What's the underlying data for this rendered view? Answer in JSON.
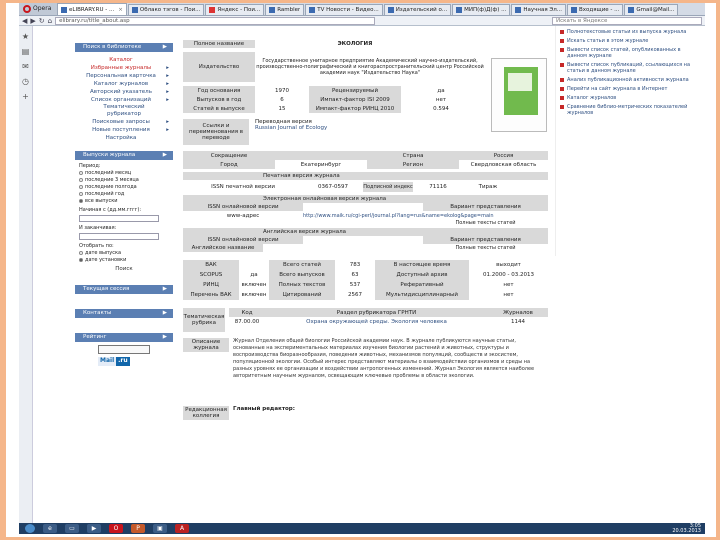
{
  "browser": {
    "app_button": "Opera",
    "tabs": [
      {
        "label": "eLIBRARY.RU - ...",
        "active": true
      },
      {
        "label": "Облако тэгов - Пои..."
      },
      {
        "label": "Яндекс - Пои..."
      },
      {
        "label": "Rambler"
      },
      {
        "label": "TV Новости - Видео..."
      },
      {
        "label": "Издательский о..."
      },
      {
        "label": "МИП(ф)Д(ф) ..."
      },
      {
        "label": "Научная Эл..."
      },
      {
        "label": "Входящие - ..."
      },
      {
        "label": "Gmail@Mail..."
      }
    ],
    "address": "elibrary.ru/title_about.asp",
    "search_placeholder": "Искать в Яндексе"
  },
  "left_nav": {
    "search_header": "Поиск в библиотеке",
    "items": [
      {
        "label": "Каталог",
        "highlight": true
      },
      {
        "label": "Избранные журналы",
        "highlight": true
      },
      {
        "label": "Персональная карточка"
      },
      {
        "label": "Каталог журналов"
      },
      {
        "label": "Авторский указатель"
      },
      {
        "label": "Список организаций"
      },
      {
        "label": "Тематический рубрикатор"
      },
      {
        "label": "Поисковые запросы"
      },
      {
        "label": "Новые поступления"
      },
      {
        "label": "Настройка"
      }
    ],
    "issues_header": "Выпуски журнала",
    "period_label": "Период:",
    "period_options": [
      {
        "label": "последний месяц",
        "on": false
      },
      {
        "label": "последние 3 месяца",
        "on": false
      },
      {
        "label": "последние полгода",
        "on": false
      },
      {
        "label": "последний год",
        "on": false
      },
      {
        "label": "все выпуски",
        "on": true
      }
    ],
    "start_label": "Начиная с (дд.мм.гггг):",
    "end_label": "И заканчивая:",
    "sort_label": "Отобрать по:",
    "sort_options": [
      {
        "label": "дате выпуска",
        "on": false
      },
      {
        "label": "дате установки",
        "on": true
      }
    ],
    "search_button": "Поиск",
    "session_header": "Текущая сессия",
    "contacts_header": "Контакты",
    "rating_header": "Рейтинг",
    "mail_brand_left": "Mail",
    "mail_brand_right": ".ru"
  },
  "journal": {
    "name_label": "Полное название",
    "name": "ЭКОЛОГИЯ",
    "publisher_label": "Издательство",
    "publisher": "Государственное унитарное предприятие Академический научно-издательский, производственно-полиграфический и книгораспространительский центр Российской академии наук \"Издательство Наука\"",
    "stats": [
      [
        "Год основания",
        "1970",
        "Рецензируемый",
        "да"
      ],
      [
        "Выпусков в год",
        "6",
        "Импакт-фактор ISI 2009",
        "нет"
      ],
      [
        "Статей в выпуске",
        "15",
        "Импакт-фактор РИНЦ 2010",
        "0.594"
      ]
    ],
    "links_label": "Ссылки и переименования в переводе",
    "translation_label": "Переводная версия",
    "translation_title": "Russian Journal of Ecology",
    "geo_header": [
      "Сокращение",
      "",
      "Страна",
      "Россия"
    ],
    "geo_values": [
      "Город",
      "Екатеринбург",
      "Регион",
      "Свердловская область"
    ],
    "print_section": "Печатная версия журнала",
    "issn_label": "ISSN печатной версии",
    "issn": "0367-0597",
    "index_label": "Подписной индекс",
    "index": "71116",
    "type": "Тираж",
    "online_section": "Электронная онлайновая версия журнала",
    "online_issn_label": "ISSN онлайновой версии",
    "online_repr_label": "Вариант представления",
    "online_site": "www-адрес",
    "online_url": "http://www.maik.ru/cgi-perl/journal.pl?lang=rus&name=ekolog&page=main",
    "online_repr": "Полные тексты статей",
    "english_section": "Английская версия журнала",
    "english_issn_label": "ISSN онлайновой версии",
    "english_repr_label": "Вариант представления",
    "english_name_label": "Английское название",
    "english_repr": "Полные тексты статей",
    "index_table": [
      [
        "ВАК",
        "",
        "Всего статей",
        "783",
        "В настоящее время",
        "выходит"
      ],
      [
        "SCOPUS",
        "да",
        "Всего выпусков",
        "63",
        "Доступный архив",
        "01.2000 - 03.2013"
      ],
      [
        "РИНЦ",
        "включен",
        "Полных текстов",
        "537",
        "Реферативный",
        "нет"
      ],
      [
        "Перечень ВАК",
        "включен",
        "Цитирований",
        "2567",
        "Мультидисциплинарный",
        "нет"
      ]
    ],
    "rubric_label": "Тематическая рубрика",
    "rubric_header": [
      "Код",
      "Раздел рубрикатора ГРНТИ",
      "Журналов"
    ],
    "rubric_row": [
      "87.00.00",
      "Охрана окружающей среды. Экология человека",
      "1144"
    ],
    "desc_label": "Описание журнала",
    "description": "Журнал Отделения общей биологии Российской академии наук. В журнале публикуются научные статьи, основанные на экспериментальных материалах изучения биологии растений и животных, структуры и воспроизводства биоразнообразия, поведения животных, механизмов популяций, сообществ и экосистем, популяционной экологии. Особый интерес представляют материалы о взаимодействии организмов и среды на разных уровнях ее организации и воздействии антропогенных изменений. Журнал Экология является наиболее авторитетным научным журналом, освещающим ключевые проблемы в области экологии.",
    "editorial_label": "Редакционная коллегия",
    "chief_editor": "Главный редактор:"
  },
  "right_col": {
    "items": [
      "Полнотекстовые статьи из выпуска журнала",
      "Искать статьи в этом журнале",
      "Вывести список статей, опубликованных в данном журнале",
      "Вывести список публикаций, ссылающихся на статьи в данном журнале",
      "Анализ публикационной активности журнала",
      "Перейти на сайт журнала в Интернет",
      "Каталог журналов",
      "Сравнение библио-метрических показателей журналов"
    ]
  },
  "taskbar": {
    "time": "3:05",
    "date": "20.03.2013"
  },
  "colors": {
    "accent_blue": "#5b7fb3",
    "link_blue": "#2d4e80",
    "highlight_red": "#c62828",
    "slide_background": "#f5b68a"
  }
}
